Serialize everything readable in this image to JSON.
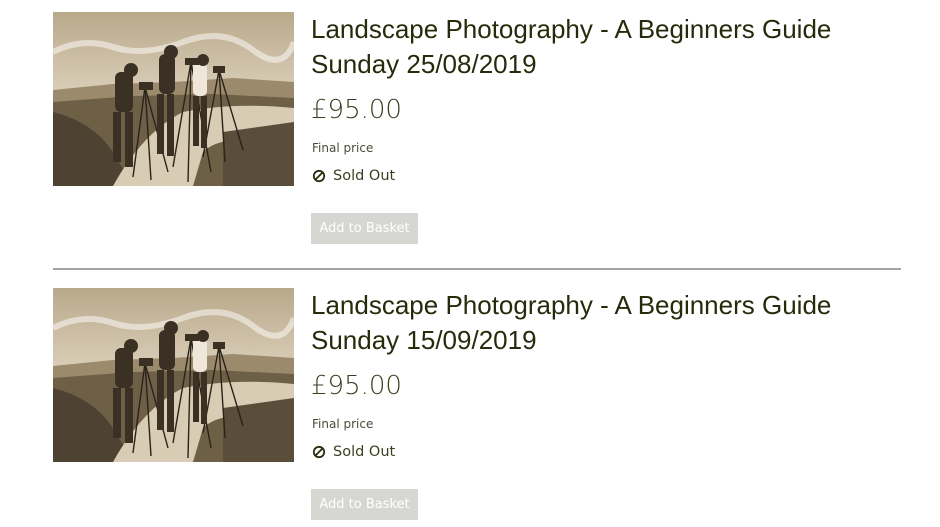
{
  "products": [
    {
      "title_line1": "Landscape Photography - A Beginners Guide",
      "title_line2": "Sunday 25/08/2019",
      "price": "£95.00",
      "price_note": "Final price",
      "availability": "Sold Out",
      "availability_icon": "prohibited-icon",
      "add_button_label": "Add to Basket",
      "image_alt": "photographers-with-tripods-photo"
    },
    {
      "title_line1": "Landscape Photography - A Beginners Guide",
      "title_line2": "Sunday 15/09/2019",
      "price": "£95.00",
      "price_note": "Final price",
      "availability": "Sold Out",
      "availability_icon": "prohibited-icon",
      "add_button_label": "Add to Basket",
      "image_alt": "photographers-with-tripods-photo"
    }
  ],
  "colors": {
    "text": "#262c0b",
    "button_disabled_bg": "#d6d6d3",
    "divider": "#a5a5a0",
    "photo_tone": "#c9b48f"
  }
}
